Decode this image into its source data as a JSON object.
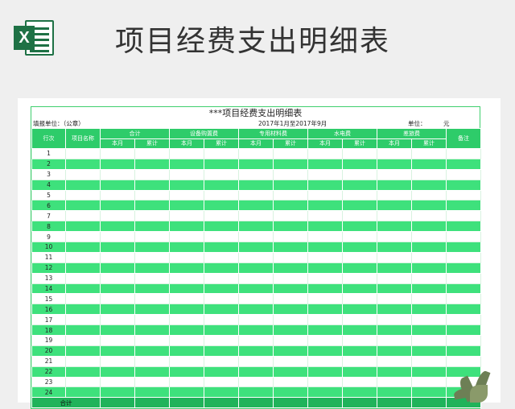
{
  "header": {
    "logo_letter": "X",
    "title": "项目经费支出明细表"
  },
  "sheet": {
    "title": "***项目经费支出明细表",
    "unit_label": "填报单位：（公章）",
    "period": "2017年1月至2017年9月",
    "currency_label": "单位：",
    "currency_value": "元",
    "columns": {
      "row_no": "行次",
      "project_name": "项目名称",
      "groups": [
        "合计",
        "设备购置费",
        "专用材料费",
        "水电费",
        "差旅费"
      ],
      "sub_current": "本月",
      "sub_cumulative": "累计",
      "remark": "备注"
    },
    "rows": [
      "1",
      "2",
      "3",
      "4",
      "5",
      "6",
      "7",
      "8",
      "9",
      "10",
      "11",
      "12",
      "13",
      "14",
      "15",
      "16",
      "17",
      "18",
      "19",
      "20",
      "21",
      "22",
      "23",
      "24"
    ],
    "total_label": "合计"
  },
  "colors": {
    "excel_green": "#1e7145",
    "header_green": "#2ecc6a",
    "row_green": "#3ee17c"
  },
  "icons": [
    "excel-icon",
    "plant-decoration"
  ]
}
